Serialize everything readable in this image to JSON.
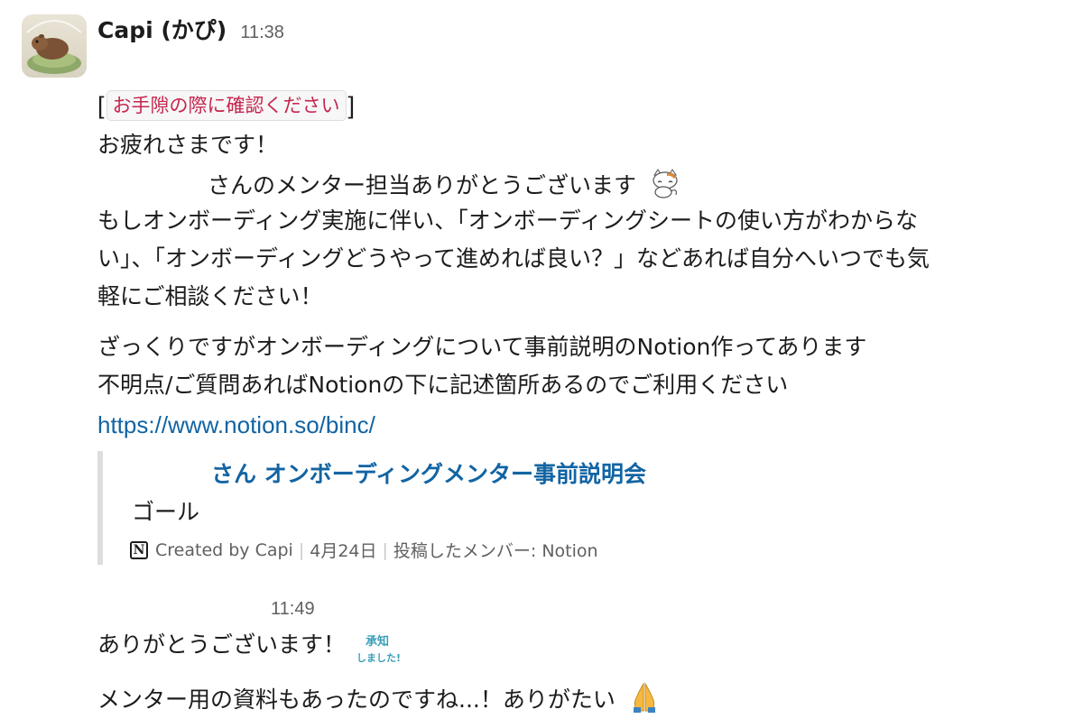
{
  "message1": {
    "sender": "Capi (かぴ)",
    "time": "11:38",
    "bracket_open": "[",
    "tag": "お手隙の際に確認ください",
    "bracket_close": "]",
    "greeting": "お疲れさまです！",
    "mentor_thanks": "さんのメンター担当ありがとうございます",
    "para1_line1": "もしオンボーディング実施に伴い、「オンボーディングシートの使い方がわからな",
    "para1_line2": "い」、「オンボーディングどうやって進めれば良い？」などあれば自分へいつでも気",
    "para1_line3": "軽にご相談ください！",
    "para2_line1": "ざっくりですがオンボーディングについて事前説明のNotion作ってあります",
    "para2_line2": "不明点/ご質問あればNotionの下に記述箇所あるのでご利用ください",
    "link": "https://www.notion.so/binc/"
  },
  "unfurl": {
    "title": "さん オンボーディングメンター事前説明会",
    "body": "ゴール",
    "icon": "N",
    "created_by": "Created by Capi",
    "date": "4月24日",
    "posted_by": "投稿したメンバー: Notion"
  },
  "message2": {
    "time": "11:49",
    "line1": "ありがとうございます！",
    "stamp_line1": "承知",
    "stamp_line2": "しました!",
    "line2": "メンター用の資料もあったのですね...！ありがたい"
  },
  "icons": {
    "avatar": "capybara-avatar",
    "cat_emoji": "cat-emoji-icon",
    "notion": "notion-icon",
    "pray_emoji": "pray-emoji-icon",
    "stamp": "acknowledged-stamp-icon"
  },
  "colors": {
    "link": "#1264a3",
    "tag_text": "#c5264d",
    "muted": "#616061"
  }
}
